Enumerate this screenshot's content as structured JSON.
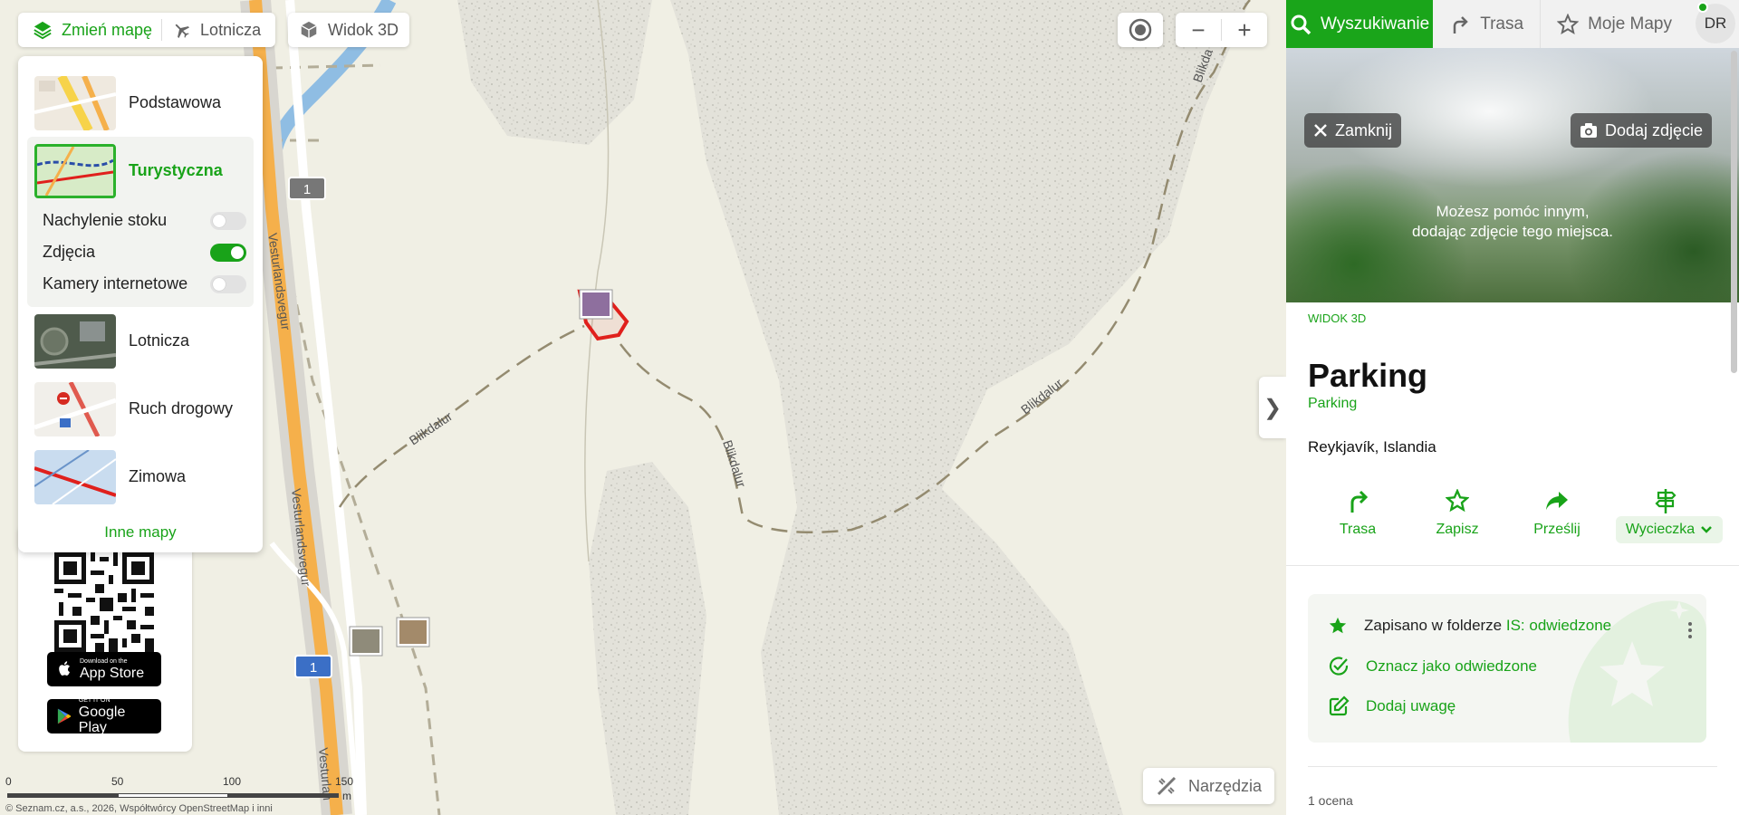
{
  "map_toolbar": {
    "change_map": "Zmień mapę",
    "aerial": "Lotnicza",
    "view3d": "Widok 3D"
  },
  "map_type_menu": {
    "items": [
      {
        "label": "Podstawowa"
      },
      {
        "label": "Turystyczna",
        "selected": true
      },
      {
        "label": "Lotnicza"
      },
      {
        "label": "Ruch drogowy"
      },
      {
        "label": "Zimowa"
      }
    ],
    "layers": [
      {
        "label": "Nachylenie stoku",
        "on": false
      },
      {
        "label": "Zdjęcia",
        "on": true
      },
      {
        "label": "Kamery internetowe",
        "on": false
      }
    ],
    "other_maps": "Inne mapy"
  },
  "map_labels": {
    "road1": "Vesturlandsvegur",
    "road2": "Vesturlandsvegur",
    "road3": "Vesturlan",
    "trail_a": "Blikdalur",
    "trail_b": "Blikdalur",
    "trail_c": "Blikdalur",
    "trail_d": "Blikda",
    "shield1": "1",
    "shield2": "1"
  },
  "promo": {
    "appstore_small": "Download on the",
    "appstore_big": "App Store",
    "googleplay_small": "GET IT ON",
    "googleplay_big": "Google Play"
  },
  "scale": {
    "ticks": [
      "0",
      "50",
      "100",
      "150"
    ],
    "unit": "m",
    "copyright": "© Seznam.cz, a.s., 2026, Współtwórcy OpenStreetMap i inni"
  },
  "tools_button": "Narzędzia",
  "panel_toggle_glyph": "❯",
  "tabs": {
    "search": "Wyszukiwanie",
    "route": "Trasa",
    "my_maps": "Moje Mapy",
    "avatar": "DR"
  },
  "photo": {
    "close": "Zamknij",
    "add_photo": "Dodaj zdjęcie",
    "hint_line1": "Możesz pomóc innym,",
    "hint_line2": "dodając zdjęcie tego miejsca."
  },
  "place": {
    "view3d_link": "WIDOK 3D",
    "title": "Parking",
    "category": "Parking",
    "location": "Reykjavík, Islandia"
  },
  "actions": {
    "route": "Trasa",
    "save": "Zapisz",
    "share": "Prześlij",
    "trip": "Wycieczka"
  },
  "saved": {
    "saved_prefix": "Zapisano w folderze",
    "folder": "IS: odwiedzone",
    "mark_visited": "Oznacz jako odwiedzone",
    "add_note": "Dodaj uwagę"
  },
  "rating": "1 ocena",
  "colors": {
    "accent": "#19a319",
    "route_red": "#e0201c",
    "road_orange": "#f5b04b",
    "water": "#8fbde3"
  }
}
